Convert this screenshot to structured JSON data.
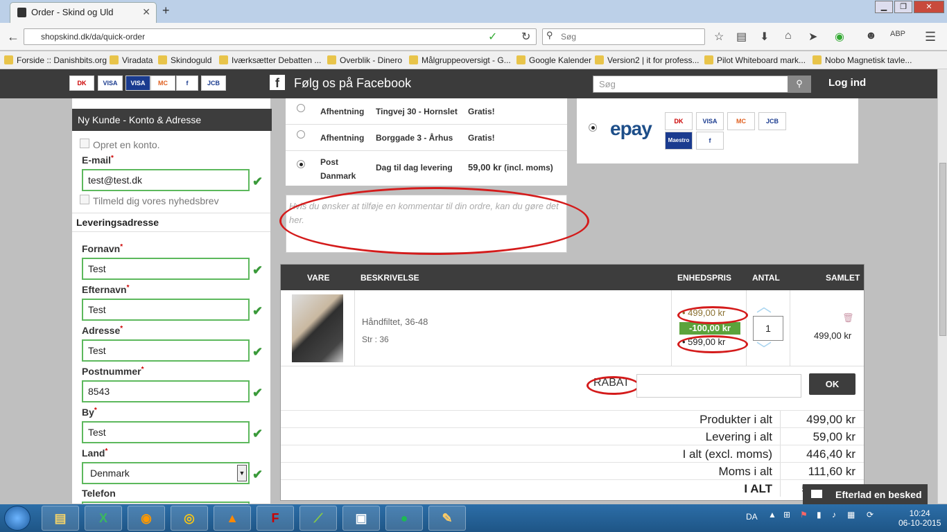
{
  "browser": {
    "tab_title": "Order - Skind og Uld",
    "url": "shopskind.dk/da/quick-order",
    "search_placeholder": "Søg",
    "bookmarks": [
      "Forside :: Danishbits.org",
      "Viradata",
      "Skindoguld",
      "Iværksætter Debatten ...",
      "Overblik - Dinero",
      "Målgruppeoversigt - G...",
      "Google Kalender",
      "Version2 | it for profess...",
      "Pilot Whiteboard mark...",
      "Nobo Magnetisk tavle..."
    ]
  },
  "site": {
    "cards": [
      "DK",
      "VISA",
      "VISA",
      "MC",
      "f",
      "JCB"
    ],
    "facebook_text": "Følg os på Facebook",
    "search_placeholder": "Søg",
    "login": "Log ind"
  },
  "customer": {
    "header": "Ny Kunde - Konto & Adresse",
    "create_account": "Opret en konto.",
    "email_label": "E-mail",
    "email_value": "test@test.dk",
    "newsletter": "Tilmeld dig vores nyhedsbrev",
    "delivery_heading": "Leveringsadresse",
    "fields": [
      {
        "label": "Fornavn",
        "value": "Test"
      },
      {
        "label": "Efternavn",
        "value": "Test"
      },
      {
        "label": "Adresse",
        "value": "Test"
      },
      {
        "label": "Postnummer",
        "value": "8543"
      },
      {
        "label": "By",
        "value": "Test"
      }
    ],
    "country_label": "Land",
    "country_value": "Denmark",
    "phone_label": "Telefon"
  },
  "delivery": [
    {
      "method": "Afhentning",
      "address": "Tingvej 30 - Hornslet",
      "price": "Gratis!",
      "selected": false
    },
    {
      "method": "Afhentning",
      "address": "Borggade 3 - Århus",
      "price": "Gratis!",
      "selected": false
    },
    {
      "method_line1": "Post",
      "method_line2": "Danmark",
      "address": "Dag til dag levering",
      "price": "59,00 kr",
      "price_note": "(incl. moms)",
      "selected": true
    }
  ],
  "comment_placeholder": "Hvis du ønsker at tilføje en kommentar til din ordre, kan du gøre det her.",
  "payment": {
    "provider": "epay",
    "cards": [
      "DK",
      "VISA",
      "MC",
      "JCB",
      "Maestro",
      "f"
    ]
  },
  "cart": {
    "headers": {
      "vare": "VARE",
      "beskrivelse": "BESKRIVELSE",
      "enhedspris": "ENHEDSPRIS",
      "antal": "ANTAL",
      "samlet": "SAMLET"
    },
    "item": {
      "name": "Håndfiltet, 36-48",
      "variant": "Str : 36",
      "price_old": "499,00 kr",
      "discount": "-100,00 kr",
      "price_new": "599,00 kr",
      "qty": "1",
      "total": "499,00 kr"
    },
    "coupon_label": "RABAT",
    "ok": "OK",
    "totals": [
      {
        "label": "Produkter i alt",
        "value": "499,00 kr"
      },
      {
        "label": "Levering i alt",
        "value": "59,00 kr"
      },
      {
        "label": "I alt (excl. moms)",
        "value": "446,40 kr"
      },
      {
        "label": "Moms i alt",
        "value": "111,60 kr"
      },
      {
        "label": "I ALT",
        "value": "5"
      }
    ]
  },
  "chat": "Efterlad en besked",
  "taskbar": {
    "lang": "DA",
    "time": "10:24",
    "date": "06-10-2015"
  }
}
